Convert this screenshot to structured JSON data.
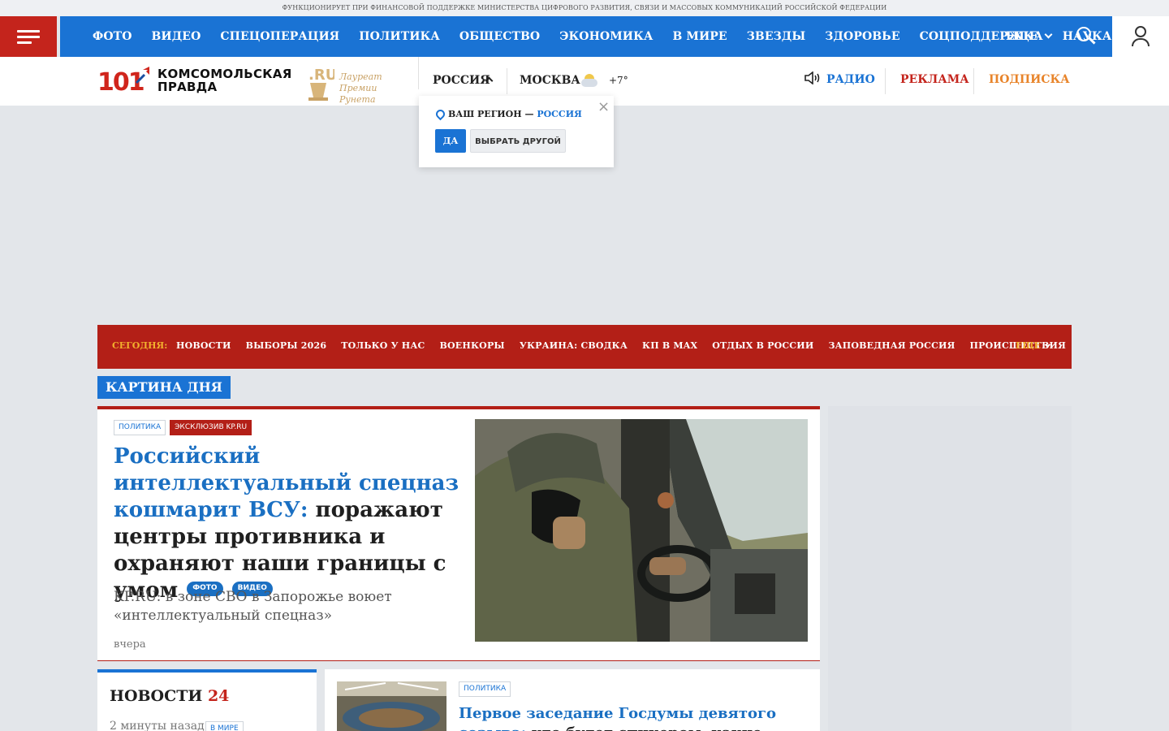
{
  "topline": "ФУНКЦИОНИРУЕТ ПРИ ФИНАНСОВОЙ ПОДДЕРЖКЕ МИНИСТЕРСТВА ЦИФРОВОГО РАЗВИТИЯ, СВЯЗИ И МАССОВЫХ КОММУНИКАЦИЙ РОССИЙСКОЙ ФЕДЕРАЦИИ",
  "nav": {
    "items": [
      "ФОТО",
      "ВИДЕО",
      "СПЕЦОПЕРАЦИЯ",
      "ПОЛИТИКА",
      "ОБЩЕСТВО",
      "ЭКОНОМИКА",
      "В МИРЕ",
      "ЗВЕЗДЫ",
      "ЗДОРОВЬЕ",
      "СОЦПОДДЕРЖКА",
      "НАУКА"
    ],
    "more": "ЕЩЕ"
  },
  "logo": {
    "number": "101",
    "name_line1": "КОМСОМОЛЬСКАЯ",
    "name_line2": "ПРАВДА"
  },
  "laureat": {
    "line1": "Лауреат",
    "line2": "Премии Рунета"
  },
  "header": {
    "region": "РОССИЯ",
    "city": "МОСКВА",
    "temperature": "+7°",
    "radio": "РАДИО",
    "ads": "РЕКЛАМА",
    "subscribe": "ПОДПИСКА"
  },
  "region_popup": {
    "question": "ВАШ РЕГИОН —",
    "region": "РОССИЯ",
    "yes": "ДА",
    "choose_other": "ВЫБРАТЬ ДРУГОЙ",
    "close": "×"
  },
  "today": {
    "label": "СЕГОДНЯ:",
    "items": [
      "НОВОСТИ",
      "ВЫБОРЫ 2026",
      "ТОЛЬКО У НАС",
      "ВОЕНКОРЫ",
      "УКРАИНА: СВОДКА",
      "КП В MAX",
      "ОТДЫХ В РОССИИ",
      "ЗАПОВЕДНАЯ РОССИЯ",
      "ПРОИСШЕСТВИЯ"
    ],
    "more": "ЕЩЕ"
  },
  "section_label": "КАРТИНА ДНЯ",
  "main_story": {
    "tags": [
      "ПОЛИТИКА",
      "ЭКСКЛЮЗИВ KP.RU"
    ],
    "title_highlight": "Российский интеллектуальный спецназ кошмарит ВСУ:",
    "title_rest": " поражают центры противника и охраняют наши границы с умом",
    "pills": [
      "ФОТО",
      "ВИДЕО"
    ],
    "lead": "KP.RU: в зоне СВО в Запорожье воюет «интеллектуальный спецназ»",
    "time": "вчера"
  },
  "news24": {
    "title": "НОВОСТИ",
    "number": "24",
    "first_time": "2 минуты назад",
    "first_tag": "В МИРЕ"
  },
  "second_story": {
    "tag": "ПОЛИТИКА",
    "title_highlight": "Первое заседание Госдумы девятого созыва:",
    "title_rest": " кто будет спикером, какие законы в приоритете и"
  },
  "colors": {
    "brand_blue": "#1a73d4",
    "brand_red": "#b31f17",
    "accent_orange": "#e8842a",
    "today_gold": "#f2b02d"
  }
}
